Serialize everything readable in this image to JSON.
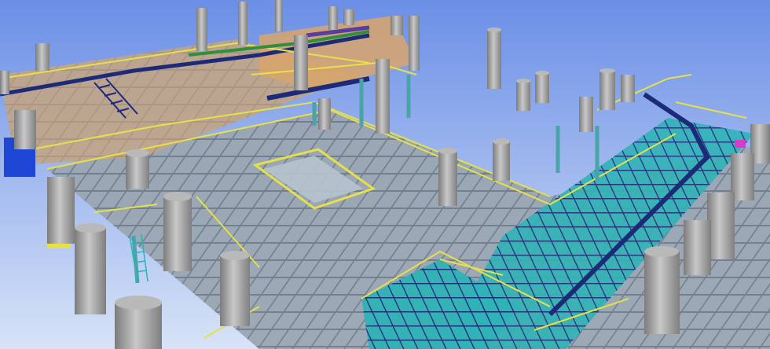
{
  "scene": {
    "description_visible_text": [],
    "colors": {
      "sky_top": "#6b8fe6",
      "sky_bottom": "#d7e3f7",
      "beam_grey": "#8e9aa6",
      "beam_grey_dark": "#6c7884",
      "column_grey": "#9a9a9a",
      "handrail_yellow": "#e6e04a",
      "plate_orange": "#d9a56b",
      "plate_cyan": "#2fb3b6",
      "cable_tray_navy": "#1d2a78",
      "accent_purple": "#5a3b9e",
      "accent_green": "#2f8f3a",
      "accent_red": "#c0392b",
      "accent_magenta": "#d43dc8",
      "accent_blue": "#1f47d6"
    },
    "icons": [
      "structural-steel-model",
      "pipe-columns",
      "handrails",
      "cable-trays",
      "stairs",
      "ladders"
    ]
  }
}
